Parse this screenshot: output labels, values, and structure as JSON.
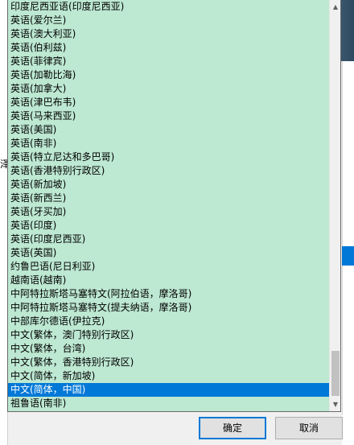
{
  "language_dropdown": {
    "items": [
      "印度尼西亚语(印度尼西亚)",
      "英语(爱尔兰)",
      "英语(澳大利亚)",
      "英语(伯利兹)",
      "英语(菲律宾)",
      "英语(加勒比海)",
      "英语(加拿大)",
      "英语(津巴布韦)",
      "英语(马来西亚)",
      "英语(美国)",
      "英语(南非)",
      "英语(特立尼达和多巴哥)",
      "英语(香港特别行政区)",
      "英语(新加坡)",
      "英语(新西兰)",
      "英语(牙买加)",
      "英语(印度)",
      "英语(印度尼西亚)",
      "英语(英国)",
      "约鲁巴语(尼日利亚)",
      "越南语(越南)",
      "中阿特拉斯塔马塞特文(阿拉伯语，摩洛哥)",
      "中阿特拉斯塔马塞特文(提夫纳语，摩洛哥)",
      "中部库尔德语(伊拉克)",
      "中文(繁体，澳门特别行政区)",
      "中文(繁体，台湾)",
      "中文(繁体，香港特别行政区)",
      "中文(简体，新加坡)",
      "中文(简体，中国)",
      "祖鲁语(南非)"
    ],
    "selected_index": 28
  },
  "background": {
    "left_fragment": "泽"
  },
  "dialog": {
    "ok_label": "确定",
    "cancel_label": "取消"
  },
  "colors": {
    "list_background": "#bde8d2",
    "selection": "#0078d7",
    "primary_button_border": "#0078d7"
  },
  "icons": {
    "scroll_up": "▲",
    "scroll_down": "▼"
  }
}
